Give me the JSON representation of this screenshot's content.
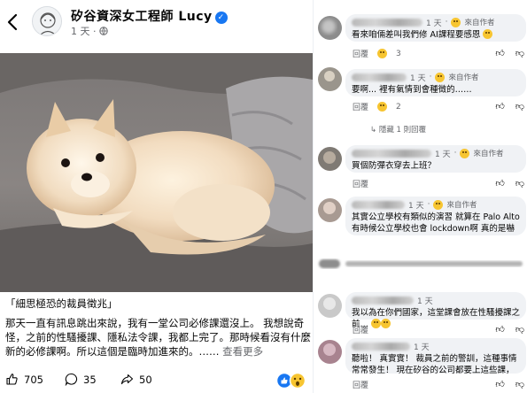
{
  "post": {
    "author": "矽谷資深女工程師 Lucy",
    "time": "1 天",
    "caption": "「細思極恐的裁員徵兆」",
    "body": "那天一直有訊息跳出來說，我有一堂公司必修課還沒上。 我想說奇怪，之前的性騷擾課、隱私法令課，我都上完了。那時候看沒有什麼新的必修課啊。所以這個是臨時加進來的。……",
    "see_more": "查看更多",
    "likes": "705",
    "comments": "35",
    "shares": "50"
  },
  "comments": [
    {
      "time": "1 天",
      "badge": "來自作者",
      "text": "看來咱倆差叫我們修 AI課程要感恩",
      "likes": "3"
    },
    {
      "time": "1 天",
      "badge": "來自作者",
      "text": "要啊... 裡有氣情到會種徵的……",
      "likes": "2"
    },
    {
      "reply_link": "隱藏 1 則回覆",
      "time": "",
      "badge": "",
      "text": "",
      "likes": ""
    },
    {
      "time": "1 天",
      "badge": "來自作者",
      "text": "買個防彈衣穿去上班？",
      "likes": ""
    },
    {
      "time": "1 天",
      "badge": "來自作者",
      "text": "其實公立學校有類似的演習 就算在 Palo Alto 有時候公立學校也會 lockdown啊 真的是嚇出家長一身冷汗",
      "likes": ""
    },
    {
      "time": "1 天",
      "badge": "",
      "text": "我以為在你們國家，這堂課會放在性騷擾課之前…",
      "likes": ""
    },
    {
      "time": "1 天",
      "badge": "",
      "text": "聽啦！ 真實實！ 裁員之前的警訓，這種事情常常發生！ 現在矽谷的公司都要上這些課，以防萬一。",
      "likes": ""
    }
  ],
  "labels": {
    "reply": "回覆",
    "author_tag": "來自作者"
  },
  "colors": {
    "accent": "#1877f2",
    "bubble": "#f0f2f5",
    "meta": "#65676b"
  }
}
